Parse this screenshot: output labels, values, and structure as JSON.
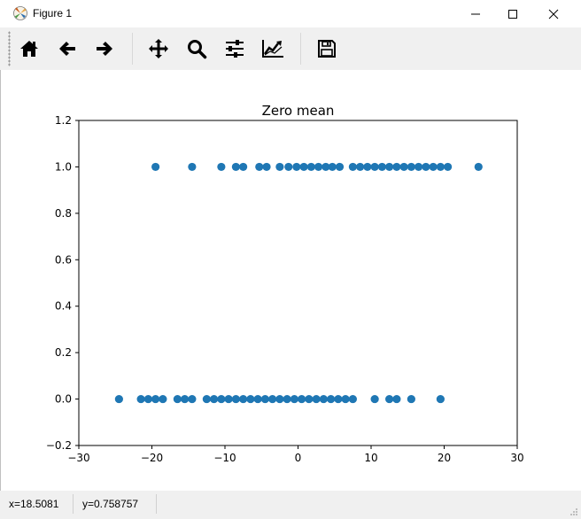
{
  "window": {
    "title": "Figure 1"
  },
  "toolbar": {
    "buttons": [
      {
        "name": "home-icon",
        "tooltip": "Home"
      },
      {
        "name": "back-icon",
        "tooltip": "Back"
      },
      {
        "name": "forward-icon",
        "tooltip": "Forward"
      },
      {
        "name": "pan-icon",
        "tooltip": "Pan"
      },
      {
        "name": "zoom-icon",
        "tooltip": "Zoom"
      },
      {
        "name": "subplots-icon",
        "tooltip": "Subplots"
      },
      {
        "name": "customize-icon",
        "tooltip": "Customize"
      },
      {
        "name": "save-icon",
        "tooltip": "Save"
      }
    ]
  },
  "status": {
    "x_readout": "x=18.5081",
    "y_readout": "y=0.758757"
  },
  "colors": {
    "marker": "#1f77b4",
    "window_bg": "#f0f0f0",
    "plot_bg": "#ffffff"
  },
  "chart_data": {
    "type": "scatter",
    "title": "Zero mean",
    "xlabel": "",
    "ylabel": "",
    "xlim": [
      -30,
      30
    ],
    "ylim": [
      -0.2,
      1.2
    ],
    "xticks": [
      -30,
      -20,
      -10,
      0,
      10,
      20,
      30
    ],
    "yticks": [
      -0.2,
      0.0,
      0.2,
      0.4,
      0.6,
      0.8,
      1.0,
      1.2
    ],
    "xtick_labels": [
      "−30",
      "−20",
      "−10",
      "0",
      "10",
      "20",
      "30"
    ],
    "ytick_labels": [
      "−0.2",
      "0.0",
      "0.2",
      "0.4",
      "0.6",
      "0.8",
      "1.0",
      "1.2"
    ],
    "grid": false,
    "series": [
      {
        "points_y1": [
          -19.5,
          -14.5,
          -10.5,
          -8.5,
          -7.5,
          -5.3,
          -4.3,
          -2.5,
          -1.3,
          -0.2,
          0.8,
          1.8,
          2.8,
          3.8,
          4.7,
          5.7,
          7.5,
          8.5,
          9.5,
          10.5,
          11.5,
          12.5,
          13.5,
          14.5,
          15.5,
          16.5,
          17.5,
          18.5,
          19.5,
          20.5,
          24.7
        ],
        "points_y0": [
          -24.5,
          -21.5,
          -20.5,
          -19.5,
          -18.5,
          -16.5,
          -15.5,
          -14.5,
          -12.5,
          -11.5,
          -10.5,
          -9.5,
          -8.5,
          -7.5,
          -6.5,
          -5.5,
          -4.5,
          -3.5,
          -2.5,
          -1.5,
          -0.5,
          0.5,
          1.5,
          2.5,
          3.5,
          4.5,
          5.5,
          6.5,
          7.5,
          10.5,
          12.5,
          13.5,
          15.5,
          19.5
        ]
      }
    ]
  }
}
